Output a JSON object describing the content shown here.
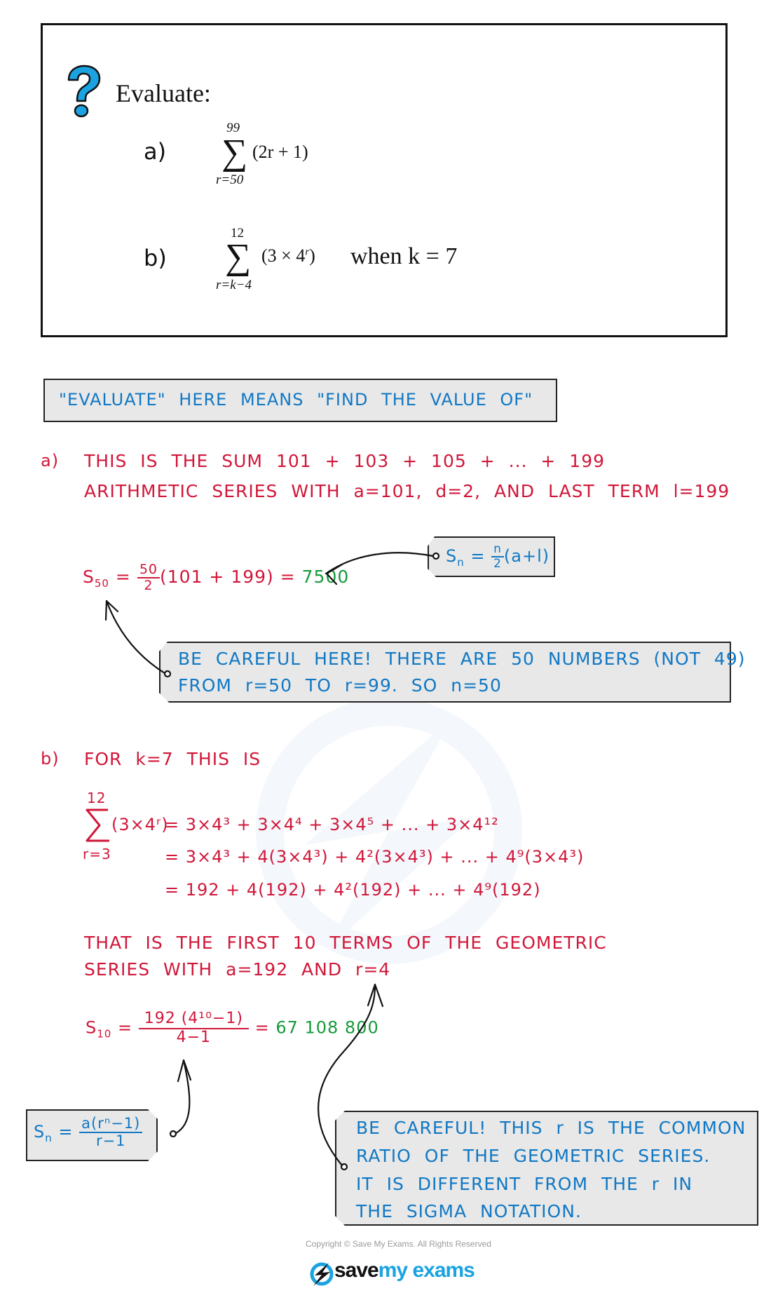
{
  "question": {
    "icon": "question-mark-icon",
    "prompt": "Evaluate:",
    "part_a": {
      "label": "a)",
      "sigma": "∑",
      "upper": "99",
      "lower": "r=50",
      "expression": "(2r + 1)"
    },
    "part_b": {
      "label": "b)",
      "sigma": "∑",
      "upper": "12",
      "lower": "r=k−4",
      "expression_open": "(3 × 4",
      "expression_exp": "r",
      "expression_close": ")",
      "condition": "when k = 7"
    }
  },
  "note": "\"EVALUATE\"  HERE  MEANS  \"FIND  THE  VALUE  OF\"",
  "solution_a": {
    "label": "a)",
    "line1": "THIS  IS  THE  SUM  101 + 103 + 105 + ... + 199",
    "line2": "ARITHMETIC  SERIES  WITH  a=101,  d=2,  AND  LAST  TERM  l=199",
    "formula": {
      "lhs": "S",
      "lhs_sub": "50",
      "eq": "=",
      "frac_num": "50",
      "frac_den": "2",
      "rest": "(101 + 199)  =",
      "result": "7500"
    },
    "tag_formula": {
      "lhs": "S",
      "lhs_sub": "n",
      "eq": "=",
      "frac_num": "n",
      "frac_den": "2",
      "rest": "(a+l)"
    },
    "warning_lines": [
      "BE  CAREFUL  HERE!  THERE  ARE  50  NUMBERS  (NOT  49)",
      "FROM  r=50  TO  r=99.  SO  n=50"
    ]
  },
  "solution_b": {
    "label": "b)",
    "line1": "FOR  k=7  THIS  IS",
    "sigma": {
      "upper": "12",
      "lower": "r=3",
      "expr": "(3×4ʳ)"
    },
    "expansion": [
      "=  3×4³ + 3×4⁴ + 3×4⁵ + ... + 3×4¹²",
      "=  3×4³ + 4(3×4³) + 4²(3×4³) + ... + 4⁹(3×4³)",
      "=  192 + 4(192) + 4²(192) + ... + 4⁹(192)"
    ],
    "geom_line1": "THAT  IS  THE  FIRST  10  TERMS  OF  THE  GEOMETRIC",
    "geom_line2": "SERIES  WITH  a=192  AND  r=4",
    "formula": {
      "lhs": "S",
      "lhs_sub": "10",
      "eq": "=",
      "frac_num": "192 (4¹⁰−1)",
      "frac_den": "4−1",
      "eq2": "=",
      "result": "67 108 800"
    },
    "tag_formula": {
      "lhs": "S",
      "lhs_sub": "n",
      "eq": "=",
      "frac_num": "a(rⁿ−1)",
      "frac_den": "r−1"
    },
    "warning_lines": [
      "BE  CAREFUL!  THIS  r  IS  THE  COMMON",
      "RATIO  OF  THE  GEOMETRIC  SERIES.",
      "IT  IS  DIFFERENT  FROM  THE  r  IN",
      "THE  SIGMA  NOTATION."
    ]
  },
  "footer": {
    "copyright": "Copyright © Save My Exams. All Rights Reserved",
    "logo_save": "save",
    "logo_myexams": "my exams",
    "logo_icon": "lightning-bolt-icon"
  },
  "colors": {
    "working": "#d1173a",
    "answer": "#179a3c",
    "note": "#1178c4",
    "note_fill": "#e8e8e8",
    "brand": "#1aa3e0"
  }
}
